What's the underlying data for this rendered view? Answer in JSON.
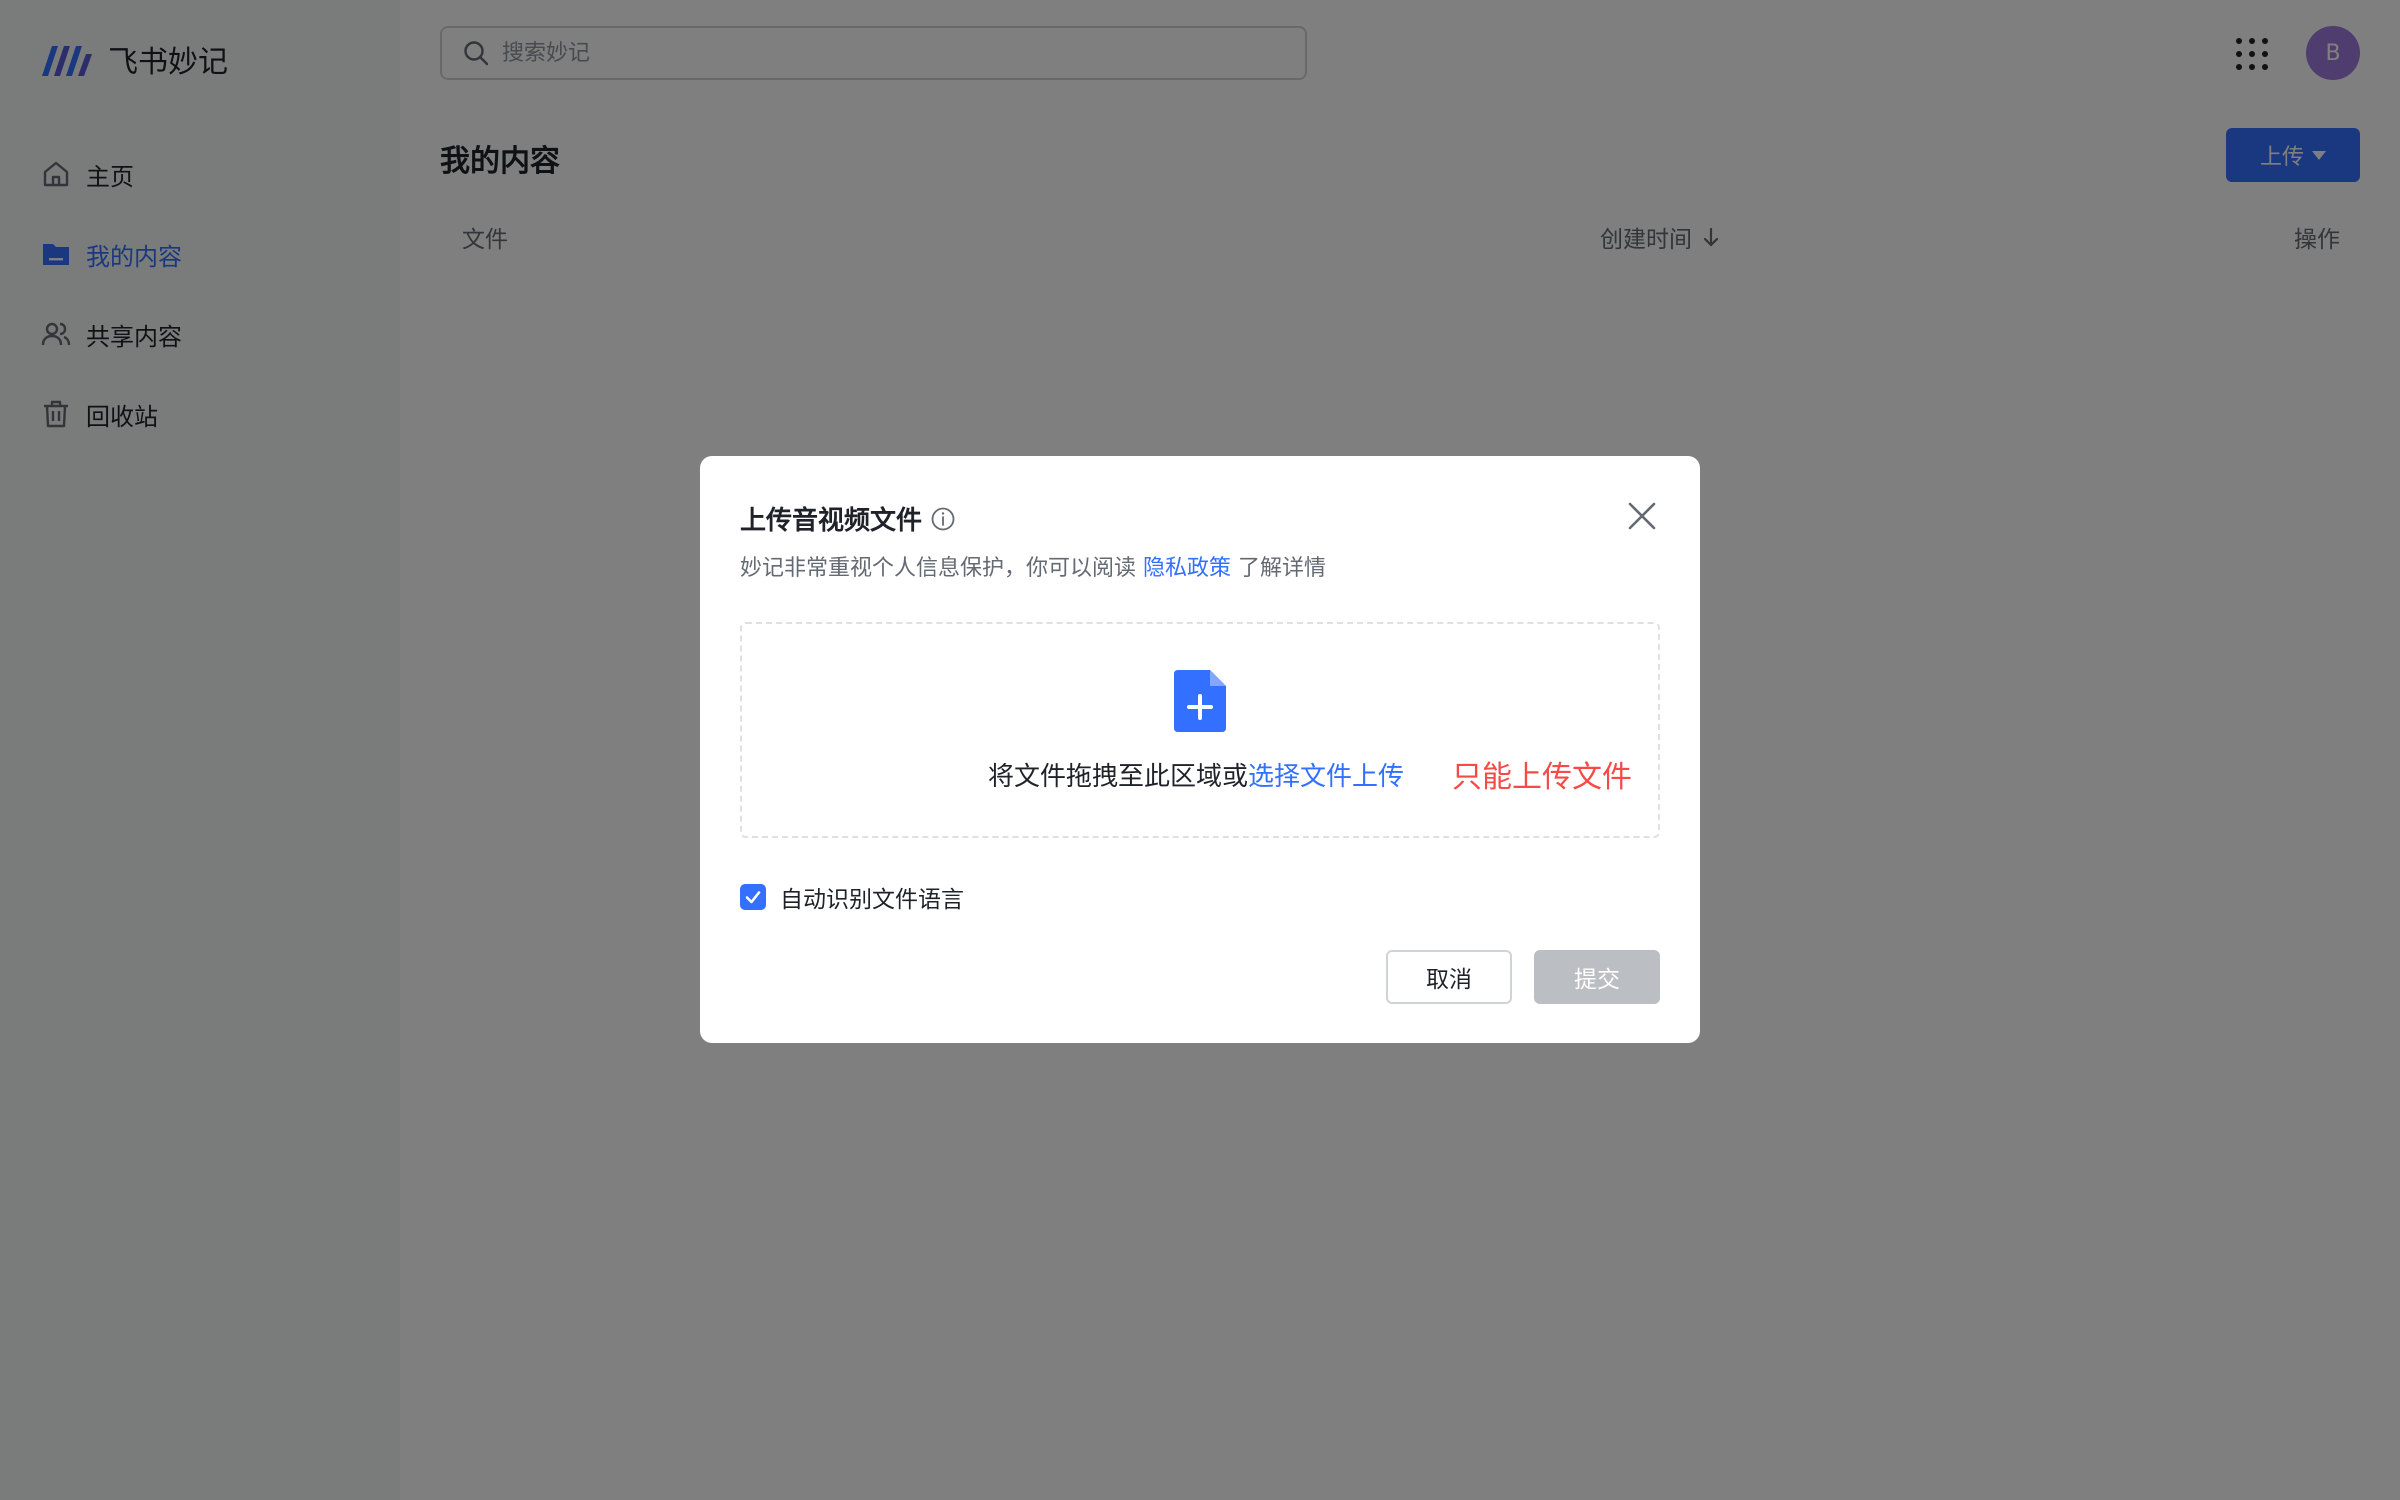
{
  "app": {
    "title": "飞书妙记"
  },
  "sidebar": {
    "items": [
      {
        "label": "主页",
        "icon": "home-icon",
        "active": false
      },
      {
        "label": "我的内容",
        "icon": "folder-icon",
        "active": true
      },
      {
        "label": "共享内容",
        "icon": "users-icon",
        "active": false
      },
      {
        "label": "回收站",
        "icon": "trash-icon",
        "active": false
      }
    ]
  },
  "header": {
    "search_placeholder": "搜索妙记",
    "avatar_initial": "B"
  },
  "main": {
    "title": "我的内容",
    "upload_label": "上传",
    "columns": {
      "file": "文件",
      "created_time": "创建时间",
      "actions": "操作"
    }
  },
  "modal": {
    "title": "上传音视频文件",
    "subtitle_prefix": "妙记非常重视个人信息保护，你可以阅读 ",
    "subtitle_link": "隐私政策",
    "subtitle_suffix": " 了解详情",
    "drop_text": "将文件拖拽至此区域或",
    "drop_link": "选择文件上传",
    "drop_warning": "只能上传文件",
    "checkbox_label": "自动识别文件语言",
    "checkbox_checked": true,
    "cancel_label": "取消",
    "submit_label": "提交"
  },
  "colors": {
    "accent": "#3370ff",
    "warning": "#f54a45",
    "disabled": "#bbbfc4",
    "avatar": "#a07be0"
  }
}
